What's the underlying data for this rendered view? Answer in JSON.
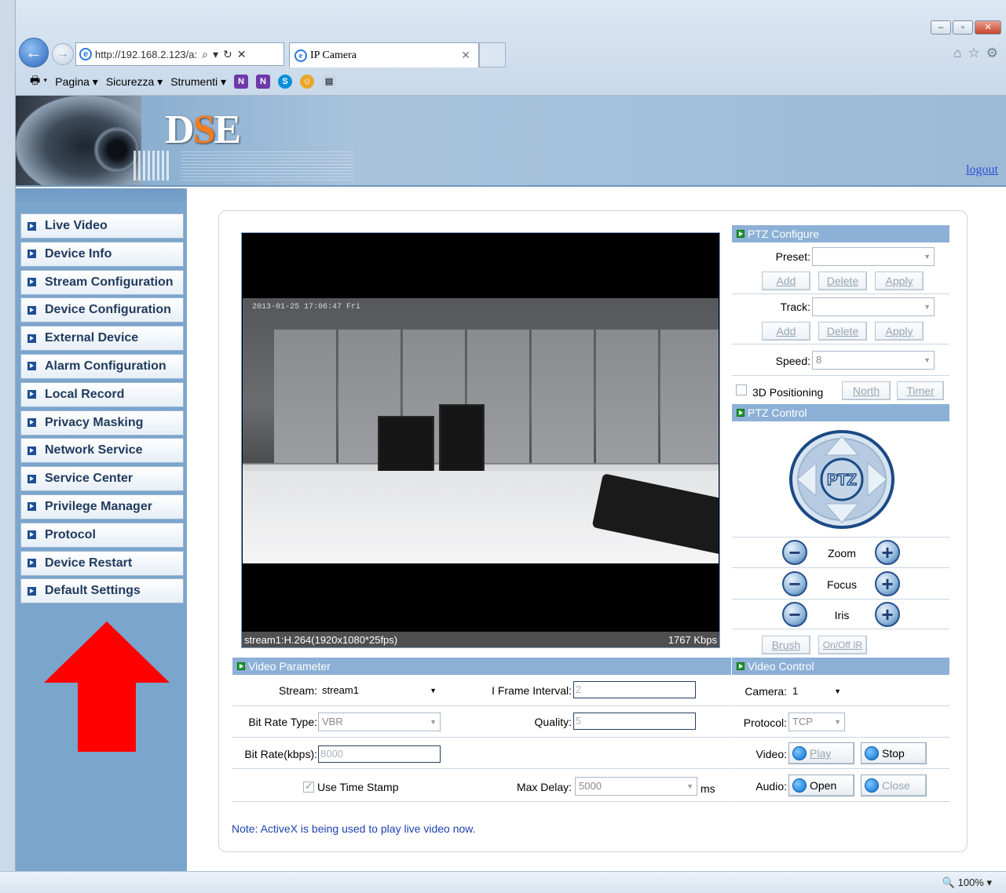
{
  "browser": {
    "address": "http://192.168.2.123/a:",
    "address_host": "192.168.2.123",
    "tab_title": "IP Camera",
    "commands": [
      "Pagina ▾",
      "Sicurezza ▾",
      "Strumenti ▾"
    ],
    "zoom": "100%"
  },
  "header": {
    "logo_d": "D",
    "logo_s": "S",
    "logo_e": "E",
    "logout": "logout"
  },
  "sidebar": {
    "items": [
      {
        "label": "Live Video"
      },
      {
        "label": "Device Info"
      },
      {
        "label": "Stream Configuration"
      },
      {
        "label": "Device Configuration"
      },
      {
        "label": "External Device"
      },
      {
        "label": "Alarm Configuration"
      },
      {
        "label": "Local Record"
      },
      {
        "label": "Privacy Masking"
      },
      {
        "label": "Network Service"
      },
      {
        "label": "Service Center"
      },
      {
        "label": "Privilege Manager"
      },
      {
        "label": "Protocol"
      },
      {
        "label": "Device Restart"
      },
      {
        "label": "Default Settings"
      }
    ]
  },
  "video": {
    "timestamp": "2013-01-25 17:06:47 Fri",
    "stream_info": "stream1:H.264(1920x1080*25fps)",
    "bitrate": "1767 Kbps"
  },
  "ptz_configure": {
    "title": "PTZ Configure",
    "preset_label": "Preset:",
    "track_label": "Track:",
    "speed_label": "Speed:",
    "speed_value": "8",
    "add": "Add",
    "delete": "Delete",
    "apply": "Apply",
    "positioning_label": "3D Positioning",
    "north": "North",
    "timer": "Timer"
  },
  "ptz_control": {
    "title": "PTZ Control",
    "pad_label": "PTZ",
    "zoom": "Zoom",
    "focus": "Focus",
    "iris": "Iris",
    "brush": "Brush",
    "onoff_ir": "On/Off IR"
  },
  "video_parameter": {
    "title": "Video Parameter",
    "stream_label": "Stream:",
    "stream_value": "stream1",
    "iframe_label": "I Frame Interval:",
    "iframe_value": "2",
    "bitrate_type_label": "Bit Rate Type:",
    "bitrate_type_value": "VBR",
    "quality_label": "Quality:",
    "quality_value": "5",
    "bitrate_label": "Bit Rate(kbps):",
    "bitrate_value": "8000",
    "timestamp_label": "Use Time Stamp",
    "max_delay_label": "Max Delay:",
    "max_delay_value": "5000",
    "ms": "ms"
  },
  "video_control": {
    "title": "Video Control",
    "camera_label": "Camera:",
    "camera_value": "1",
    "protocol_label": "Protocol:",
    "protocol_value": "TCP",
    "video_label": "Video:",
    "play": "Play",
    "stop": "Stop",
    "audio_label": "Audio:",
    "open": "Open",
    "close": "Close"
  },
  "note": "Note: ActiveX is being used to play live video now."
}
